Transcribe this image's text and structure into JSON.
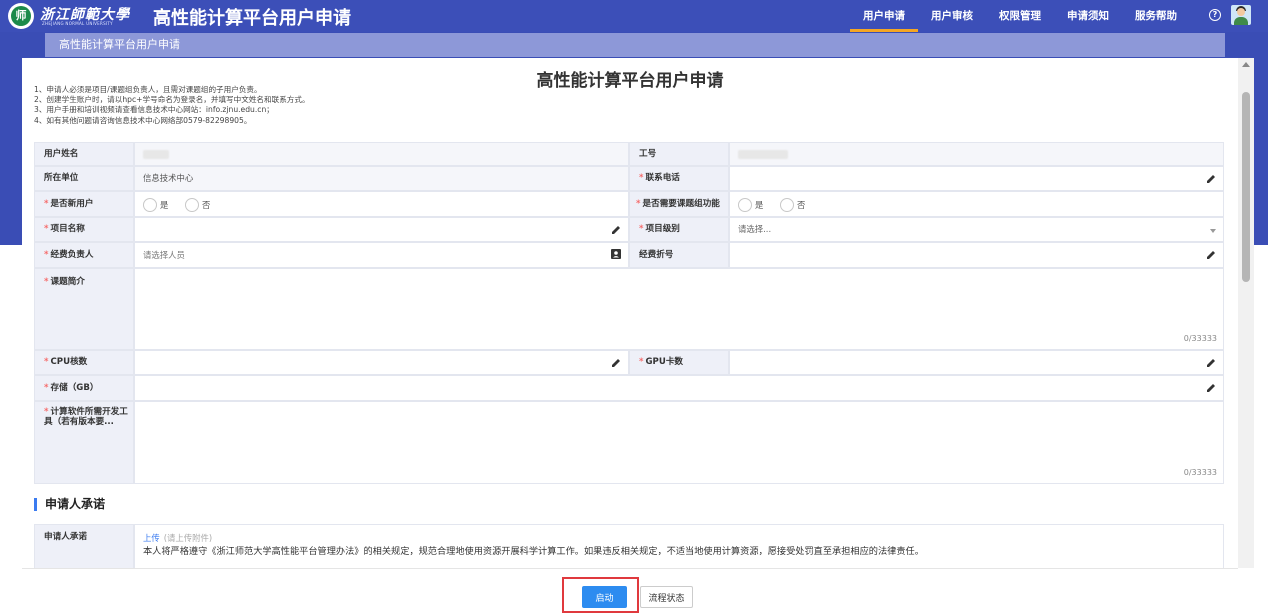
{
  "header": {
    "logo_text": "师",
    "school_cn": "浙江師範大學",
    "school_en": "ZHEJIANG NORMAL UNIVERSITY",
    "app_title": "高性能计算平台用户申请",
    "nav": [
      "用户申请",
      "用户审核",
      "权限管理",
      "申请须知",
      "服务帮助"
    ],
    "active_nav": "用户申请",
    "help_icon": "question-circle-icon",
    "avatar_icon": "user-avatar-icon"
  },
  "subbar": {
    "label": "高性能计算平台用户申请"
  },
  "form": {
    "title": "高性能计算平台用户申请",
    "notes": [
      "1、申请人必须是项目/课题组负责人，且需对课题组的子用户负责。",
      "2、创建学生账户时，请以hpc+学号命名为登录名，并填写中文姓名和联系方式。",
      "3、用户手册和培训视频请查看信息技术中心网站：info.zjnu.edu.cn；",
      "4、如有其他问题请咨询信息技术中心网络部0579-82298905。"
    ],
    "fields": {
      "user_name": {
        "label": "用户姓名"
      },
      "job_no": {
        "label": "工号"
      },
      "unit": {
        "label": "所在单位",
        "value": "信息技术中心"
      },
      "phone": {
        "label": "联系电话"
      },
      "new_user": {
        "label": "是否新用户",
        "options": [
          "是",
          "否"
        ]
      },
      "need_group": {
        "label": "是否需要课题组功能",
        "options": [
          "是",
          "否"
        ]
      },
      "project_name": {
        "label": "项目名称"
      },
      "project_level": {
        "label": "项目级别",
        "placeholder": "请选择..."
      },
      "funding_owner": {
        "label": "经费负责人",
        "placeholder": "请选择人员"
      },
      "funding_no": {
        "label": "经费折号"
      },
      "intro": {
        "label": "课题简介",
        "counter": "0/33333"
      },
      "cpu": {
        "label": "CPU核数"
      },
      "gpu": {
        "label": "GPU卡数"
      },
      "storage": {
        "label": "存储（GB）"
      },
      "software": {
        "label": "计算软件所需开发工具（若有版本要...",
        "counter": "0/33333"
      }
    }
  },
  "commitment": {
    "section_title": "申请人承诺",
    "label": "申请人承诺",
    "upload": "上传",
    "upload_hint": "(请上传附件)",
    "text": "本人将严格遵守《浙江师范大学高性能平台管理办法》的相关规定，规范合理地使用资源开展科学计算工作。如果违反相关规定，不适当地使用计算资源，愿接受处罚直至承担相应的法律责任。"
  },
  "actions": {
    "start": "启动",
    "flow_status": "流程状态"
  },
  "colors": {
    "primary": "#3c4fb8",
    "accent": "#2d8cf0",
    "required": "#f56c6c",
    "highlight": "#e0393e"
  }
}
